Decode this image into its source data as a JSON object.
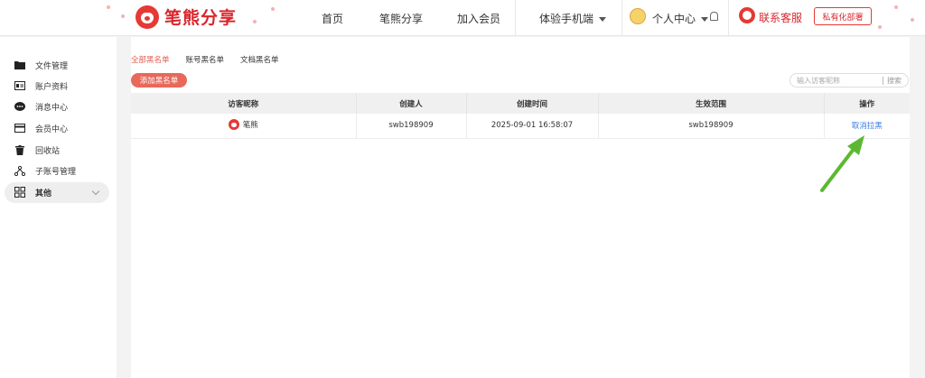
{
  "colors": {
    "brand": "#d9262d",
    "accent": "#e8685a",
    "link": "#3b7be0",
    "arrow": "#5cb832"
  },
  "header": {
    "brand_name": "笔熊分享",
    "nav": [
      "首页",
      "笔熊分享",
      "加入会员",
      "体验手机端"
    ],
    "user_center": "个人中心",
    "service": "联系客服",
    "private_deploy": "私有化部署"
  },
  "sidebar": {
    "items": [
      {
        "label": "文件管理",
        "icon": "folder-icon"
      },
      {
        "label": "账户资料",
        "icon": "id-card-icon"
      },
      {
        "label": "消息中心",
        "icon": "message-icon"
      },
      {
        "label": "会员中心",
        "icon": "card-icon"
      },
      {
        "label": "回收站",
        "icon": "trash-icon"
      },
      {
        "label": "子账号管理",
        "icon": "org-icon"
      },
      {
        "label": "其他",
        "icon": "grid-icon"
      }
    ]
  },
  "main": {
    "tabs": [
      "全部黑名单",
      "账号黑名单",
      "文档黑名单"
    ],
    "active_tab": "全部黑名单",
    "add_button": "添加黑名单",
    "search": {
      "placeholder": "输入访客昵称",
      "button": "搜索"
    },
    "table": {
      "headers": [
        "访客昵称",
        "创建人",
        "创建时间",
        "生效范围",
        "操作"
      ],
      "rows": [
        {
          "visitor": "笔熊",
          "creator": "swb198909",
          "created_at": "2025-09-01 16:58:07",
          "scope": "swb198909",
          "action": "取消拉黑"
        }
      ]
    }
  }
}
